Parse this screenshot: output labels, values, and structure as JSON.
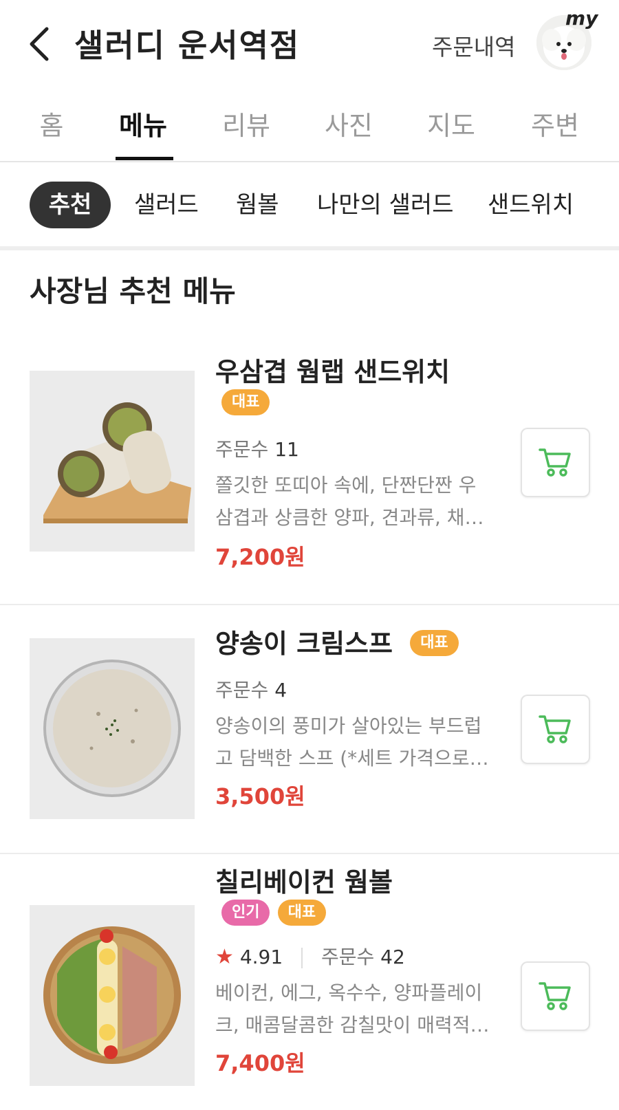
{
  "header": {
    "title": "샐러디 운서역점",
    "order_history": "주문내역",
    "my_label": "my"
  },
  "tabs": [
    {
      "label": "홈"
    },
    {
      "label": "메뉴",
      "active": true
    },
    {
      "label": "리뷰"
    },
    {
      "label": "사진"
    },
    {
      "label": "지도"
    },
    {
      "label": "주변"
    }
  ],
  "categories": [
    {
      "label": "추천",
      "active": true
    },
    {
      "label": "샐러드"
    },
    {
      "label": "웜볼"
    },
    {
      "label": "나만의 샐러드"
    },
    {
      "label": "샌드위치"
    }
  ],
  "section_title": "사장님 추천 메뉴",
  "items": [
    {
      "name": "우삼겹 웜랩 샌드위치",
      "badges": [
        "대표"
      ],
      "order_label": "주문수",
      "order_count": "11",
      "desc_1": "쫄깃한 또띠아 속에, 단짠단짠 우",
      "desc_2": "삼겹과 상큼한 양파, 견과류, 채…",
      "price": "7,200원"
    },
    {
      "name": "양송이 크림스프",
      "badges": [
        "대표"
      ],
      "order_label": "주문수",
      "order_count": "4",
      "desc_1": "양송이의 풍미가 살아있는 부드럽",
      "desc_2": "고 담백한 스프 (*세트 가격으로…",
      "price": "3,500원"
    },
    {
      "name": "칠리베이컨 웜볼",
      "badges": [
        "인기",
        "대표"
      ],
      "rating": "4.91",
      "order_label": "주문수",
      "order_count": "42",
      "desc_1": "베이컨, 에그, 옥수수, 양파플레이",
      "desc_2": "크, 매콤달콤한 감칠맛이 매력적…",
      "price": "7,400원"
    }
  ],
  "colors": {
    "price": "#e0453a",
    "badge_rep": "#f5a93a",
    "badge_pop": "#e86aa8",
    "cart_green": "#4cbb5a"
  }
}
